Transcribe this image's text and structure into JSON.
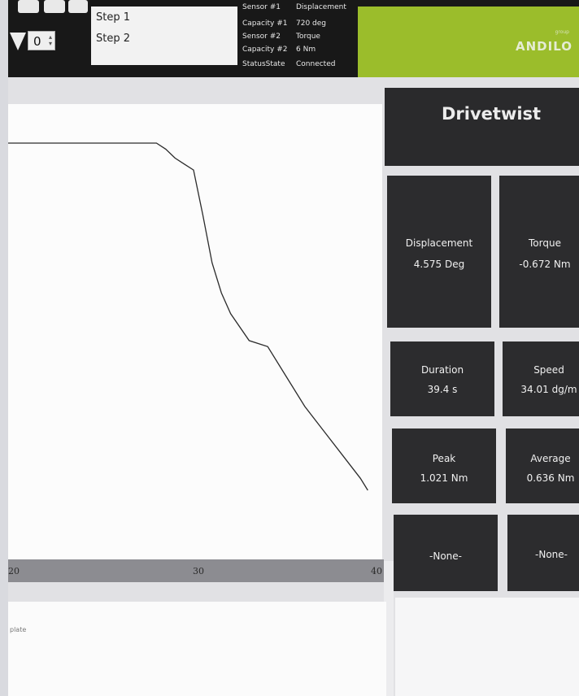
{
  "top": {
    "step_value": "0",
    "steps": [
      "Step 1",
      "Step 2"
    ],
    "sensor_rows": [
      {
        "label": "Sensor #1",
        "value": "Displacement"
      },
      {
        "label": "Capacity #1",
        "value": "720 deg"
      },
      {
        "label": "Sensor #2",
        "value": "Torque"
      },
      {
        "label": "Capacity #2",
        "value": "6 Nm"
      },
      {
        "label": "StatusState",
        "value": "Connected"
      }
    ],
    "logo": "ANDILO",
    "logo_small": "group"
  },
  "chart": {
    "x_ticks": [
      "20",
      "30",
      "40"
    ],
    "template_label": "plate"
  },
  "chart_data": {
    "type": "line",
    "xlim": [
      20,
      40
    ],
    "series": [
      {
        "values_x": [
          20,
          28,
          28.5,
          29,
          29.5,
          30,
          30.5,
          31,
          31.5,
          32,
          33,
          34,
          35,
          36,
          37,
          38,
          39,
          39.4
        ],
        "values_y": [
          1.0,
          1.0,
          0.98,
          0.95,
          0.93,
          0.91,
          0.76,
          0.6,
          0.5,
          0.43,
          0.34,
          0.32,
          0.22,
          0.12,
          0.04,
          -0.04,
          -0.12,
          -0.16
        ]
      }
    ]
  },
  "panel": {
    "title": "Drivetwist",
    "tiles": [
      {
        "label": "Displacement",
        "value": "4.575 Deg"
      },
      {
        "label": "Torque",
        "value": "-0.672 Nm"
      },
      {
        "label": "Duration",
        "value": "39.4 s"
      },
      {
        "label": "Speed",
        "value": "34.01 dg/m"
      },
      {
        "label": "Peak",
        "value": "1.021 Nm"
      },
      {
        "label": "Average",
        "value": "0.636 Nm"
      },
      {
        "label": "-None-",
        "value": ""
      },
      {
        "label": "-None-",
        "value": ""
      }
    ]
  },
  "colors": {
    "accent_green": "#9bbd2b",
    "tile_bg": "#2c2c2e"
  }
}
